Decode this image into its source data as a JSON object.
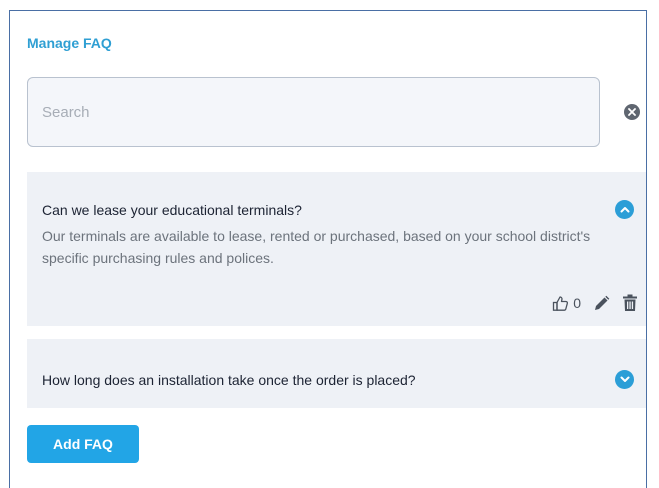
{
  "panel": {
    "title": "Manage FAQ",
    "accent_color": "#2f9fd3",
    "button_color": "#22a5e6"
  },
  "search": {
    "placeholder": "Search",
    "value": "",
    "clear_icon": "circle-x-icon"
  },
  "faqs": [
    {
      "question": "Can we lease your educational terminals?",
      "answer": "Our terminals are available to lease, rented or purchased, based on your school district's specific purchasing rules and polices.",
      "expanded": true,
      "likes": "0",
      "icons": [
        "thumbs-up-icon",
        "pencil-icon",
        "trash-icon",
        "chevron-up-icon"
      ]
    },
    {
      "question": "How long does an installation take once the order is placed?",
      "expanded": false,
      "icons": [
        "chevron-down-icon"
      ]
    }
  ],
  "add_button": {
    "label": "Add FAQ"
  }
}
